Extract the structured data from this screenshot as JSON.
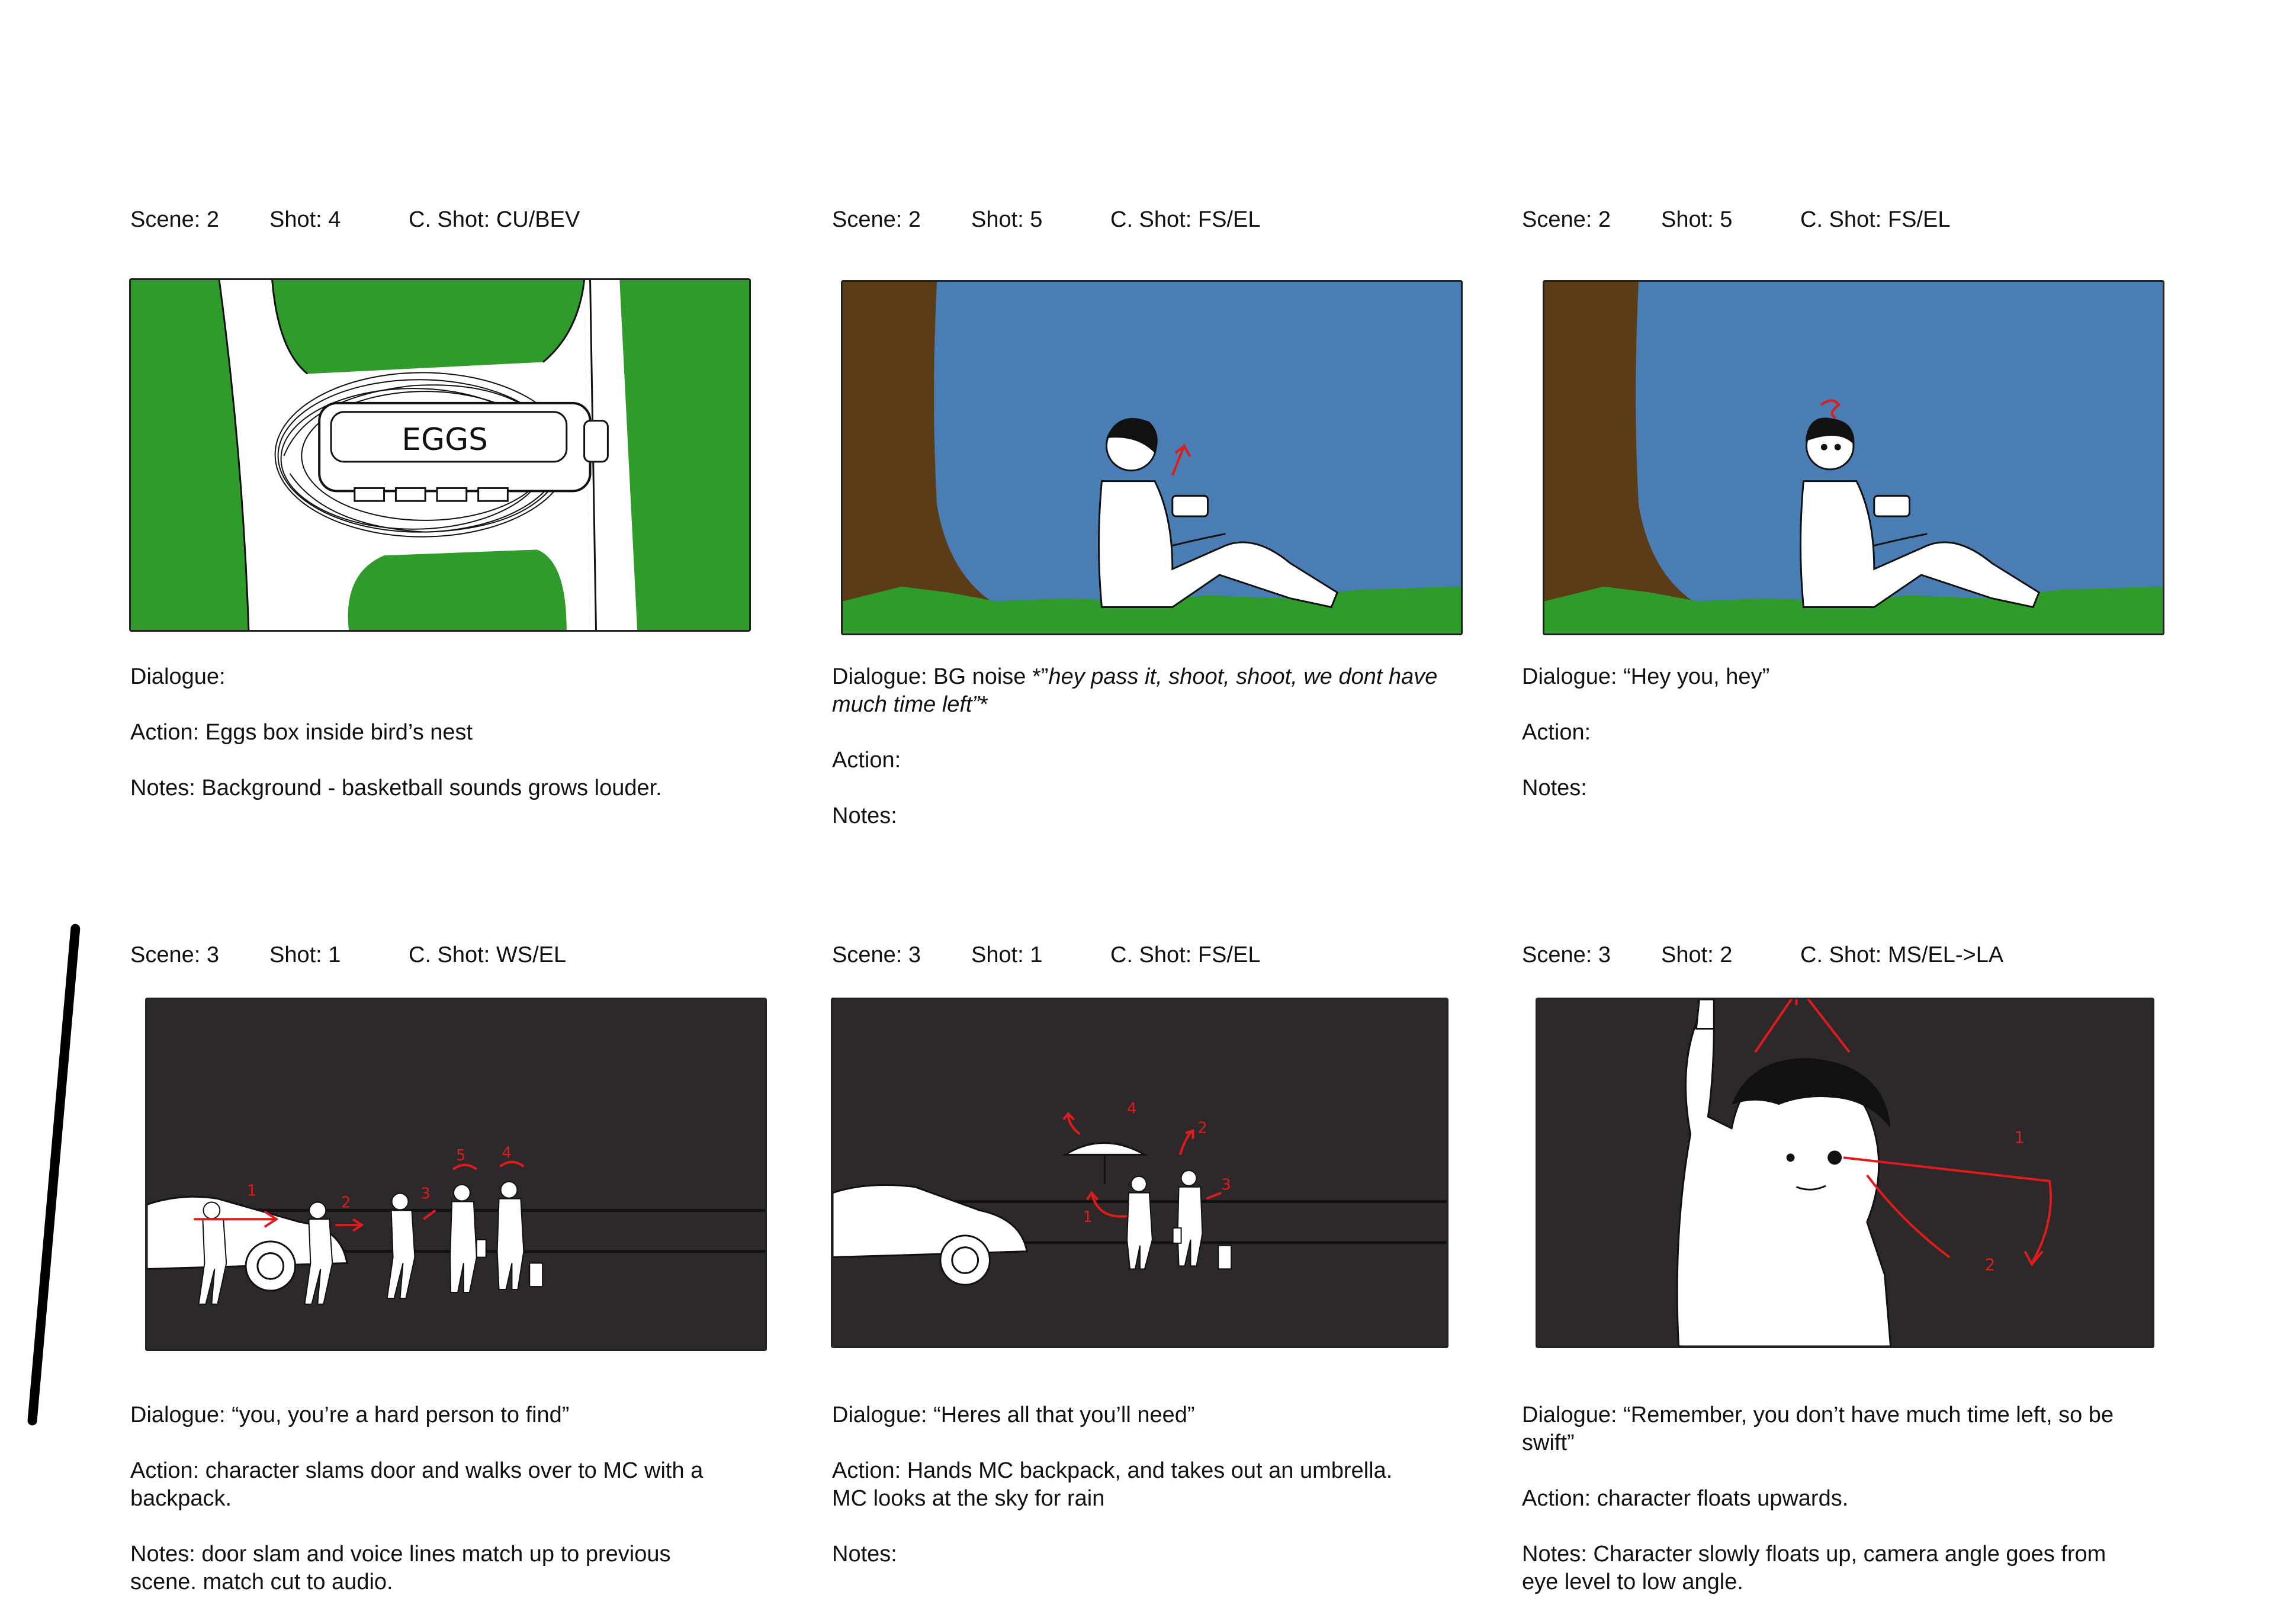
{
  "labels": {
    "scene": "Scene:",
    "shot": "Shot:",
    "cshot": "C. Shot:",
    "dialogue": "Dialogue:",
    "action": "Action:",
    "notes": "Notes:"
  },
  "panels": [
    {
      "scene": "2",
      "shot": "4",
      "camera_shot": "CU/BEV",
      "frame_text": "EGGS",
      "dialogue": "",
      "action": "Eggs box inside bird’s nest",
      "notes": "Background - basketball sounds grows louder."
    },
    {
      "scene": "2",
      "shot": "5",
      "camera_shot": "FS/EL",
      "dialogue_prefix": "BG noise *”",
      "dialogue": "hey pass it, shoot, shoot, we dont have much time left”",
      "dialogue_suffix": "*",
      "action": "",
      "notes": ""
    },
    {
      "scene": "2",
      "shot": "5",
      "camera_shot": "FS/EL",
      "dialogue": "“Hey you, hey”",
      "action": "",
      "notes": ""
    },
    {
      "scene": "3",
      "shot": "1",
      "camera_shot": "WS/EL",
      "dialogue": "“you, you’re a hard person to find”",
      "action": "character slams door and walks over to MC with a backpack.",
      "notes": "door slam and voice lines match up to previous scene. match cut to audio."
    },
    {
      "scene": "3",
      "shot": "1",
      "camera_shot": "FS/EL",
      "dialogue": "“Heres all that you’ll need”",
      "action": "Hands MC backpack, and takes out an umbrella. MC looks at the sky for rain",
      "notes": ""
    },
    {
      "scene": "3",
      "shot": "2",
      "camera_shot": "MS/EL->LA",
      "dialogue": "“Remember, you don’t have much time left, so be swift”",
      "action": "character floats upwards.",
      "notes": "Character slowly floats up, camera angle goes from eye level to low angle."
    }
  ],
  "sketch_marks": [
    "1",
    "2",
    "3",
    "4",
    "5"
  ],
  "colors": {
    "grass": "#2e9b2b",
    "sky": "#4b7db5",
    "tree": "#5b3c16",
    "night": "#2d2829",
    "annotation": "#e01b1b"
  }
}
